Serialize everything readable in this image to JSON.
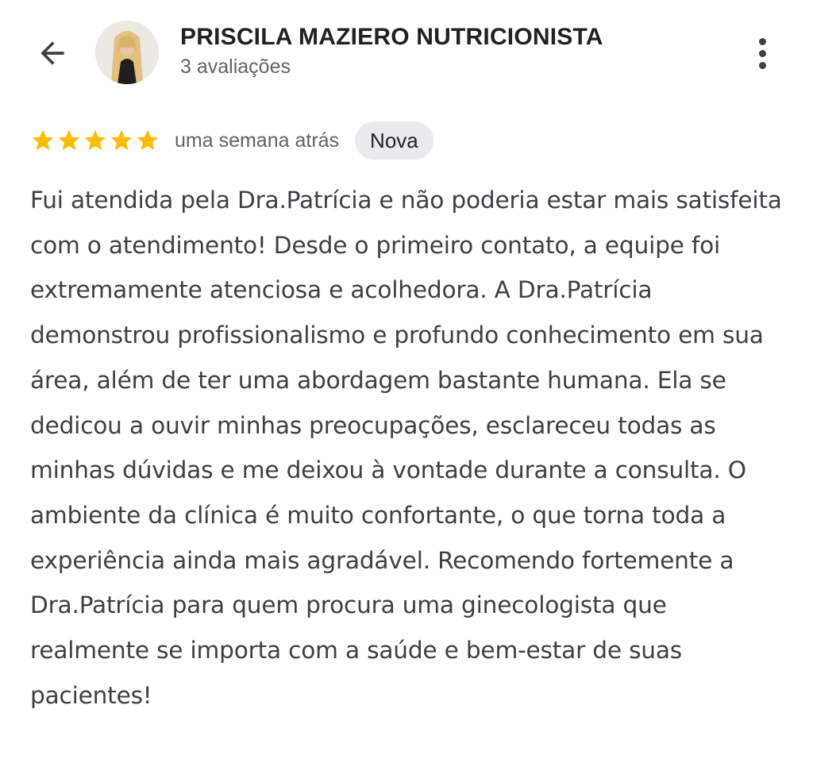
{
  "header": {
    "place_name": "PRISCILA MAZIERO NUTRICIONISTA",
    "review_count": "3 avaliações",
    "back_icon": "arrow-back-icon",
    "more_icon": "more-vert-icon"
  },
  "review": {
    "rating": 5,
    "rating_max": 5,
    "star_color": "#fbbc04",
    "time_ago": "uma semana atrás",
    "badge": "Nova",
    "text": "Fui atendida pela Dra.Patrícia e não poderia estar mais satisfeita com o atendimento! Desde o primeiro contato, a equipe foi extremamente atenciosa e acolhedora. A Dra.Patrícia demonstrou profissionalismo e profundo conhecimento em sua área, além de ter uma abordagem bastante humana. Ela se dedicou a ouvir minhas preocupações, esclareceu todas as minhas dúvidas e me deixou à vontade durante a consulta. O ambiente da clínica é muito confortante, o que torna toda a experiência ainda mais agradável. Recomendo fortemente a Dra.Patrícia para quem procura uma ginecologista que realmente se importa com a saúde e bem-estar de suas pacientes!"
  }
}
